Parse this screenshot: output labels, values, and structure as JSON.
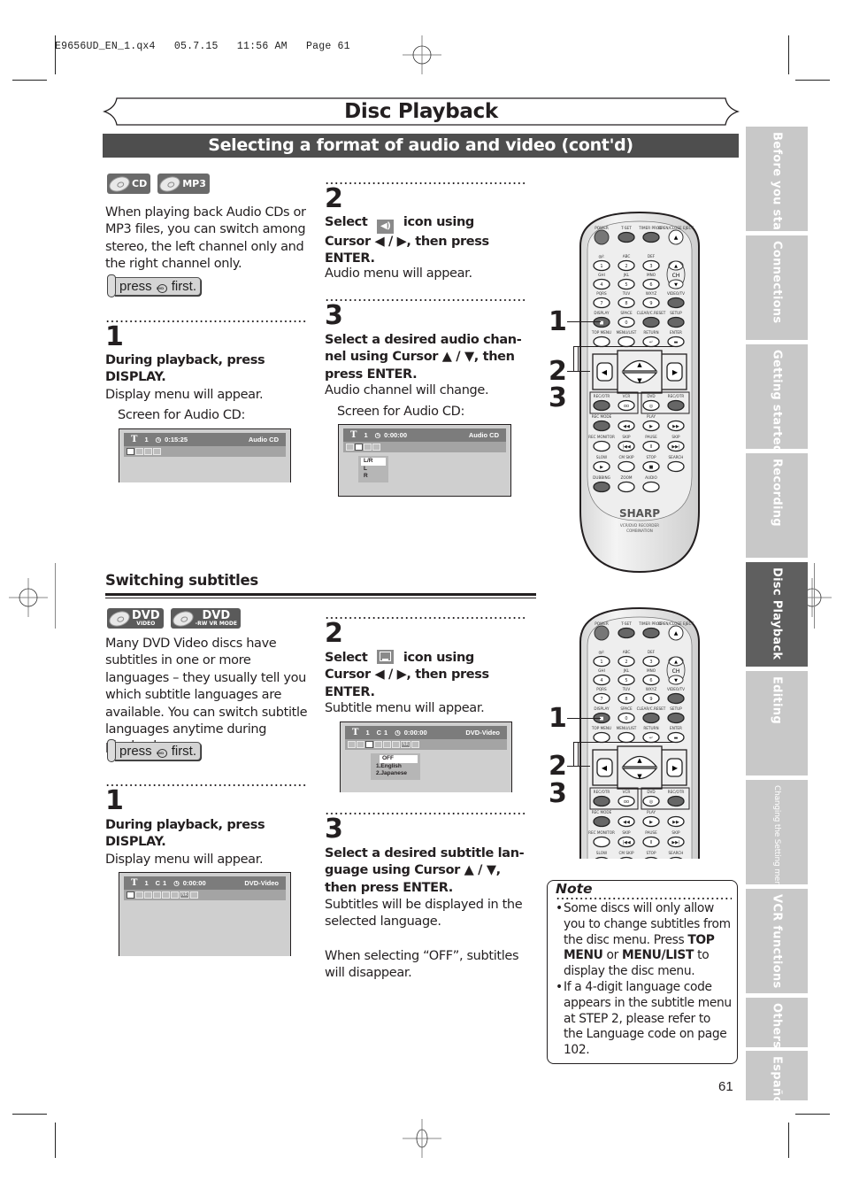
{
  "slug": "E9656UD_EN_1.qx4   05.7.15   11:56 AM   Page 61",
  "page_title": "Disc Playback",
  "section_title": "Selecting a format of audio and video (cont'd)",
  "page_number": "61",
  "side_tabs": [
    {
      "label": "Before you start",
      "active": false
    },
    {
      "label": "Connections",
      "active": false
    },
    {
      "label": "Getting started",
      "active": false
    },
    {
      "label": "Recording",
      "active": false
    },
    {
      "label": "Disc Playback",
      "active": true
    },
    {
      "label": "Editing",
      "active": false
    },
    {
      "label": "Changing the Setting menu",
      "active": false
    },
    {
      "label": "VCR functions",
      "active": false
    },
    {
      "label": "Others",
      "active": false
    },
    {
      "label": "Español",
      "active": false
    }
  ],
  "audio": {
    "badges": [
      "CD",
      "MP3"
    ],
    "intro": "When playing back Audio CDs or MP3 files, you can switch among stereo, the left channel only and the right channel only.",
    "press_first": {
      "before": "press",
      "after": "first.",
      "icon": "dvd-button-icon"
    },
    "step1": {
      "num": "1",
      "instruction_line1": "During playback, press",
      "instruction_line2": "DISPLAY.",
      "result": "Display menu will appear.",
      "caption": "Screen for Audio CD:",
      "osd": {
        "title_num": "1",
        "time": "0:15:25",
        "disc_type": "Audio CD"
      }
    },
    "step2": {
      "num": "2",
      "select": "Select",
      "icon_using": "icon using",
      "cursor_line": "Cursor ◀ / ▶, then press",
      "enter": "ENTER.",
      "result": "Audio menu will appear.",
      "icon": "audio-speaker-icon"
    },
    "step3": {
      "num": "3",
      "instruction_line1": "Select a desired audio chan-",
      "instruction_line2": "nel using Cursor ▲ / ▼, then",
      "instruction_line3": "press ENTER.",
      "result": "Audio channel will change.",
      "caption": "Screen for Audio CD:",
      "osd": {
        "title_num": "1",
        "time": "0:00:00",
        "disc_type": "Audio CD",
        "menu": [
          "L/R",
          "L",
          "R"
        ],
        "selected": "L/R"
      }
    }
  },
  "subtitles": {
    "heading": "Switching subtitles",
    "badges": [
      {
        "main": "DVD",
        "sub": "VIDEO"
      },
      {
        "main": "DVD",
        "sub": "-RW VR MODE"
      }
    ],
    "intro": "Many DVD Video discs have subtitles in one or more languages – they usually tell you which subtitle languages are available.  You can switch subtitle languages anytime during playback.",
    "press_first": {
      "before": "press",
      "after": "first.",
      "icon": "dvd-button-icon"
    },
    "step1": {
      "num": "1",
      "instruction_line1": "During playback, press",
      "instruction_line2": "DISPLAY.",
      "result": "Display menu will appear.",
      "osd": {
        "title_num": "1",
        "chapter_num": "1",
        "time": "0:00:00",
        "disc_type": "DVD-Video"
      }
    },
    "step2": {
      "num": "2",
      "select": "Select",
      "icon_using": "icon using",
      "cursor_line": "Cursor ◀ / ▶, then press",
      "enter": "ENTER.",
      "result": "Subtitle menu will appear.",
      "icon": "subtitle-icon",
      "osd": {
        "title_num": "1",
        "chapter_num": "1",
        "time": "0:00:00",
        "disc_type": "DVD-Video",
        "menu": [
          "OFF",
          "1.English",
          "2.Japanese"
        ],
        "selected": "OFF"
      }
    },
    "step3": {
      "num": "3",
      "instruction_line1": "Select a desired subtitle lan-",
      "instruction_line2": "guage using Cursor ▲ / ▼,",
      "instruction_line3": "then press ENTER.",
      "result": "Subtitles will be displayed in the selected language.",
      "result2": "When selecting “OFF”, subtitles will disappear."
    }
  },
  "note": {
    "title": "Note",
    "items": [
      {
        "pre": "Some discs will only allow you to change subtitles from the disc menu. Press ",
        "b1": "TOP MENU",
        "mid": " or ",
        "b2": "MENU/LIST",
        "post": " to display the disc menu."
      },
      {
        "pre": "If a 4-digit language code appears in the subtitle menu at STEP 2, please refer to the Language code on page 102."
      }
    ]
  },
  "remote": {
    "callouts": [
      "1",
      "2",
      "3"
    ],
    "brand": "SHARP",
    "model_line1": "VCR/DVD RECORDER",
    "model_line2": "COMBINATION",
    "buttons": {
      "power": "POWER",
      "tset": "T-SET",
      "timer": "TIMER PROG.",
      "eject": "OPEN/CLOSE EJECT",
      "k1": "@/:",
      "k2": "ABC",
      "k3": "DEF",
      "k4": "GHI",
      "k5": "JKL",
      "k6": "MNO",
      "k7": "PQRS",
      "k8": "TUV",
      "k9": "WXYZ",
      "videotv": "VIDEO/TV",
      "ch": "CH",
      "display": "DISPLAY",
      "space": "SPACE",
      "clear": "CLEAR/C.RESET",
      "setup": "SETUP",
      "topmenu": "TOP MENU",
      "menulist": "MENU/LIST",
      "return": "RETURN",
      "enter": "ENTER",
      "recotr": "REC/OTR",
      "vcr": "VCR",
      "dvd": "DVD",
      "recmode": "REC MODE",
      "play": "PLAY",
      "recmonitor": "REC MONITOR",
      "skip": "SKIP",
      "pause": "PAUSE",
      "slow": "SLOW",
      "cmskip": "CM SKIP",
      "stop": "STOP",
      "search": "SEARCH",
      "dubbing": "DUBBING",
      "zoom": "ZOOM",
      "audio": "AUDIO"
    }
  }
}
